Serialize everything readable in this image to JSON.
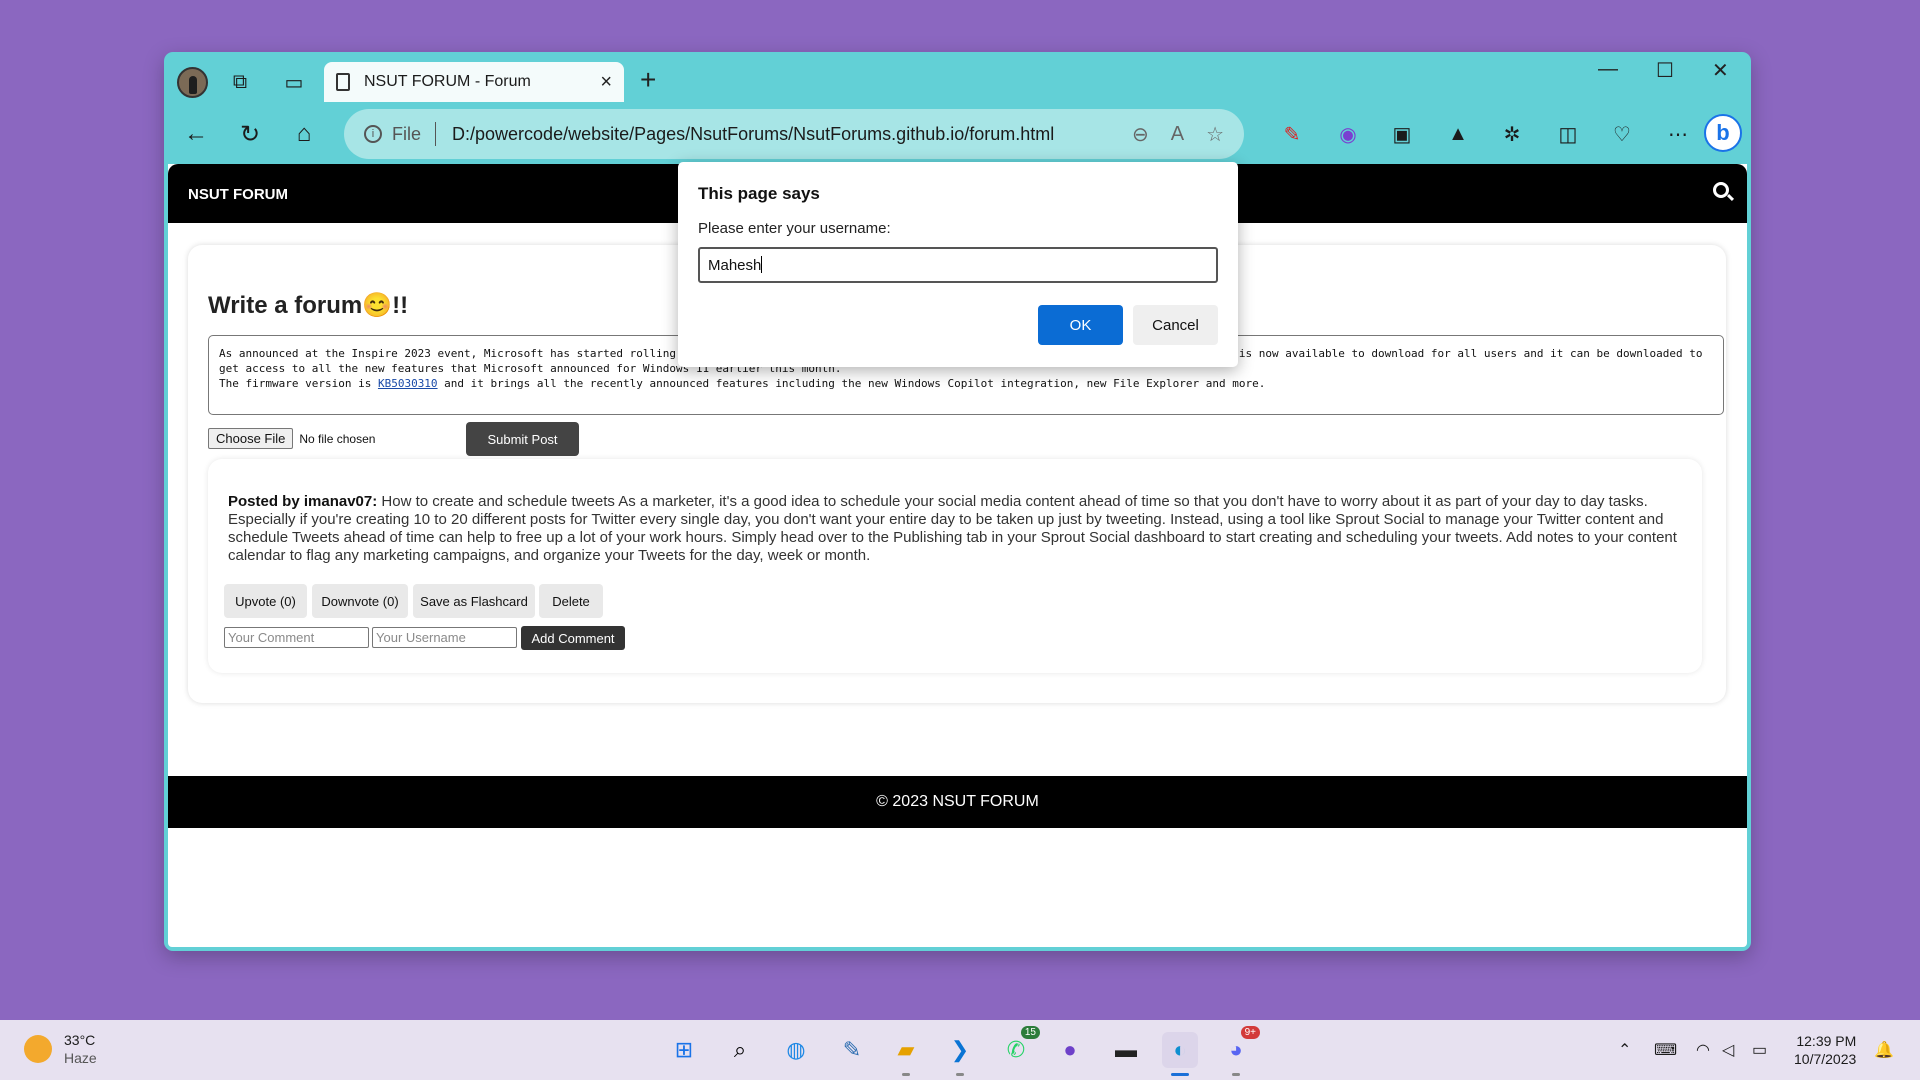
{
  "browser": {
    "tab_title": "NSUT FORUM - Forum",
    "url_label": "File",
    "url": "D:/powercode/website/Pages/NsutForums/NsutForums.github.io/forum.html"
  },
  "site": {
    "brand": "NSUT FORUM",
    "heading": "Write a forum😊!!",
    "textarea_value": "As announced at the Inspire 2023 event, Microsoft has started rolling out the Windows 11 Moment 3 update for all users running compatible PCs. The update is now available to download for all users and it can be downloaded to get access to all the new features that Microsoft announced for Windows 11 earlier this month.",
    "textarea_line3_a": "The firmware version is ",
    "textarea_kb": "KB5030310",
    "textarea_line3_b": " and it brings all the recently announced features including the new Windows Copilot integration, new File Explorer and more.",
    "choose_file_label": "Choose File",
    "no_file_label": "No file chosen",
    "submit_label": "Submit Post",
    "post": {
      "author_prefix": "Posted by imanav07:",
      "content": " How to create and schedule tweets As a marketer, it's a good idea to schedule your social media content ahead of time so that you don't have to worry about it as part of your day to day tasks. Especially if you're creating 10 to 20 different posts for Twitter every single day, you don't want your entire day to be taken up just by tweeting. Instead, using a tool like Sprout Social to manage your Twitter content and schedule Tweets ahead of time can help to free up a lot of your work hours. Simply head over to the Publishing tab in your Sprout Social dashboard to start creating and scheduling your tweets. Add notes to your content calendar to flag any marketing campaigns, and organize your Tweets for the day, week or month.",
      "upvote_label": "Upvote (0)",
      "downvote_label": "Downvote (0)",
      "flashcard_label": "Save as Flashcard",
      "delete_label": "Delete",
      "comment_placeholder": "Your Comment",
      "username_placeholder": "Your Username",
      "add_comment_label": "Add Comment"
    },
    "footer": "© 2023 NSUT FORUM"
  },
  "dialog": {
    "title": "This page says",
    "message": "Please enter your username:",
    "input_value": "Mahesh",
    "ok_label": "OK",
    "cancel_label": "Cancel"
  },
  "taskbar": {
    "temperature": "33°C",
    "condition": "Haze",
    "time": "12:39 PM",
    "date": "10/7/2023",
    "whatsapp_badge": "15",
    "discord_badge": "9+"
  },
  "colors": {
    "browser_frame": "#62d0d6",
    "desktop": "#8b67c0",
    "ok_button": "#0b6cd4"
  }
}
